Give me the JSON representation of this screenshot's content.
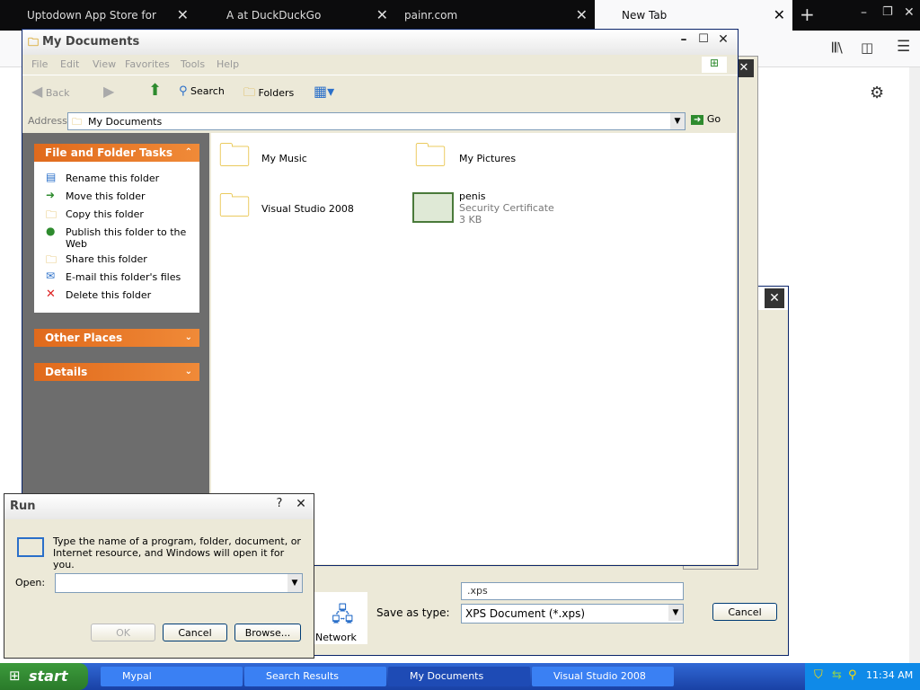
{
  "browser": {
    "tabs": [
      {
        "label": "Uptodown App Store for Android"
      },
      {
        "label": "A at DuckDuckGo"
      },
      {
        "label": "painr.com"
      },
      {
        "label": "New Tab"
      }
    ],
    "new_tab_symbol": "+"
  },
  "explorer": {
    "title": "My Documents",
    "menu": [
      "File",
      "Edit",
      "View",
      "Favorites",
      "Tools",
      "Help"
    ],
    "toolbar": {
      "back": "Back",
      "search": "Search",
      "folders": "Folders"
    },
    "address": {
      "label": "Address",
      "value": "My Documents",
      "go": "Go"
    },
    "panels": {
      "file_folder_tasks": "File and Folder Tasks",
      "tasks": [
        {
          "label": "Rename this folder",
          "icon": "rename-icon"
        },
        {
          "label": "Move this folder",
          "icon": "move-icon"
        },
        {
          "label": "Copy this folder",
          "icon": "copy-icon"
        },
        {
          "label": "Publish this folder to the Web",
          "icon": "globe-icon"
        },
        {
          "label": "Share this folder",
          "icon": "share-icon"
        },
        {
          "label": "E-mail this folder's files",
          "icon": "email-icon"
        },
        {
          "label": "Delete this folder",
          "icon": "delete-icon"
        }
      ],
      "other_places": "Other Places",
      "details": "Details"
    },
    "items": [
      {
        "name": "My Music"
      },
      {
        "name": "My Pictures"
      },
      {
        "name": "Visual Studio 2008"
      },
      {
        "name": "penis",
        "type": "Security Certificate",
        "size": "3 KB"
      }
    ]
  },
  "save_dialog": {
    "save_as_type_label": "Save as type:",
    "save_as_type_value": "XPS Document (*.xps)",
    "file_name_value": ".xps",
    "cancel": "Cancel",
    "network": "Network"
  },
  "run": {
    "title": "Run",
    "description": "Type the name of a program, folder, document, or Internet resource, and Windows will open it for you.",
    "open_label": "Open:",
    "ok": "OK",
    "cancel": "Cancel",
    "browse": "Browse..."
  },
  "taskbar": {
    "start": "start",
    "tasks": [
      "Mypal",
      "Search Results",
      "My Documents",
      "Visual Studio 2008"
    ],
    "clock": "11:34 AM"
  },
  "colors": {
    "xp_blue": "#245edb",
    "task_orange": "#e06a1c",
    "taskbar": "#245edb"
  }
}
